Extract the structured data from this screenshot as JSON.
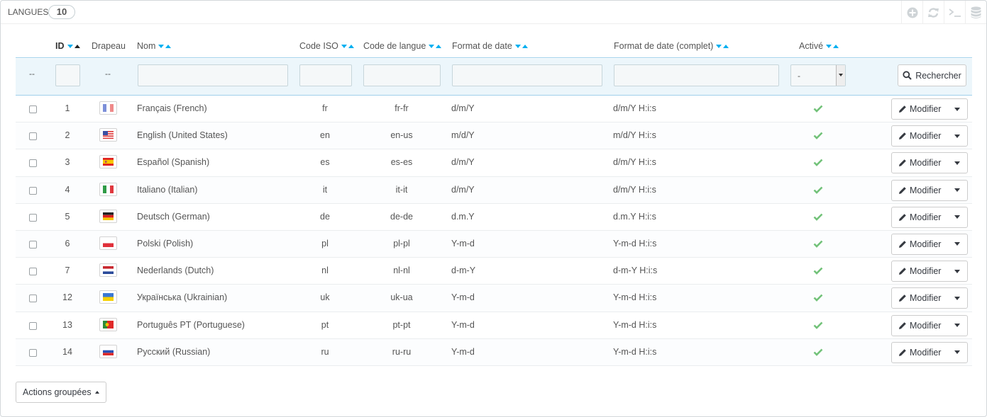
{
  "panel": {
    "title": "Langues",
    "count": "10",
    "toolbar": [
      {
        "icon": "add-icon"
      },
      {
        "icon": "refresh-icon"
      },
      {
        "icon": "sql-terminal-icon"
      },
      {
        "icon": "database-icon"
      }
    ]
  },
  "columns": {
    "id": "ID",
    "flag": "Drapeau",
    "name": "Nom",
    "iso": "Code ISO",
    "lang_code": "Code de langue",
    "date_format": "Format de date",
    "date_format_full": "Format de date (complet)",
    "active": "Activé"
  },
  "filters": {
    "select_dash": "--",
    "flag_dash": "--",
    "active_value": "-",
    "search_label": "Rechercher"
  },
  "rows": [
    {
      "id": "1",
      "flag": "fr",
      "name": "Français (French)",
      "iso": "fr",
      "lang": "fr-fr",
      "date": "d/m/Y",
      "date_full": "d/m/Y H:i:s"
    },
    {
      "id": "2",
      "flag": "us",
      "name": "English (United States)",
      "iso": "en",
      "lang": "en-us",
      "date": "m/d/Y",
      "date_full": "m/d/Y H:i:s"
    },
    {
      "id": "3",
      "flag": "es",
      "name": "Español (Spanish)",
      "iso": "es",
      "lang": "es-es",
      "date": "d/m/Y",
      "date_full": "d/m/Y H:i:s"
    },
    {
      "id": "4",
      "flag": "it",
      "name": "Italiano (Italian)",
      "iso": "it",
      "lang": "it-it",
      "date": "d/m/Y",
      "date_full": "d/m/Y H:i:s"
    },
    {
      "id": "5",
      "flag": "de",
      "name": "Deutsch (German)",
      "iso": "de",
      "lang": "de-de",
      "date": "d.m.Y",
      "date_full": "d.m.Y H:i:s"
    },
    {
      "id": "6",
      "flag": "pl",
      "name": "Polski (Polish)",
      "iso": "pl",
      "lang": "pl-pl",
      "date": "Y-m-d",
      "date_full": "Y-m-d H:i:s"
    },
    {
      "id": "7",
      "flag": "nl",
      "name": "Nederlands (Dutch)",
      "iso": "nl",
      "lang": "nl-nl",
      "date": "d-m-Y",
      "date_full": "d-m-Y H:i:s"
    },
    {
      "id": "12",
      "flag": "ua",
      "name": "Українська (Ukrainian)",
      "iso": "uk",
      "lang": "uk-ua",
      "date": "Y-m-d",
      "date_full": "Y-m-d H:i:s"
    },
    {
      "id": "13",
      "flag": "pt",
      "name": "Português PT (Portuguese)",
      "iso": "pt",
      "lang": "pt-pt",
      "date": "Y-m-d",
      "date_full": "Y-m-d H:i:s"
    },
    {
      "id": "14",
      "flag": "ru",
      "name": "Русский (Russian)",
      "iso": "ru",
      "lang": "ru-ru",
      "date": "Y-m-d",
      "date_full": "Y-m-d H:i:s"
    }
  ],
  "row_actions": {
    "edit_label": "Modifier"
  },
  "bulk": {
    "label": "Actions groupées"
  },
  "colors": {
    "accent": "#00aff0",
    "check": "#72c279",
    "filter_bg": "#ecf6fb"
  }
}
